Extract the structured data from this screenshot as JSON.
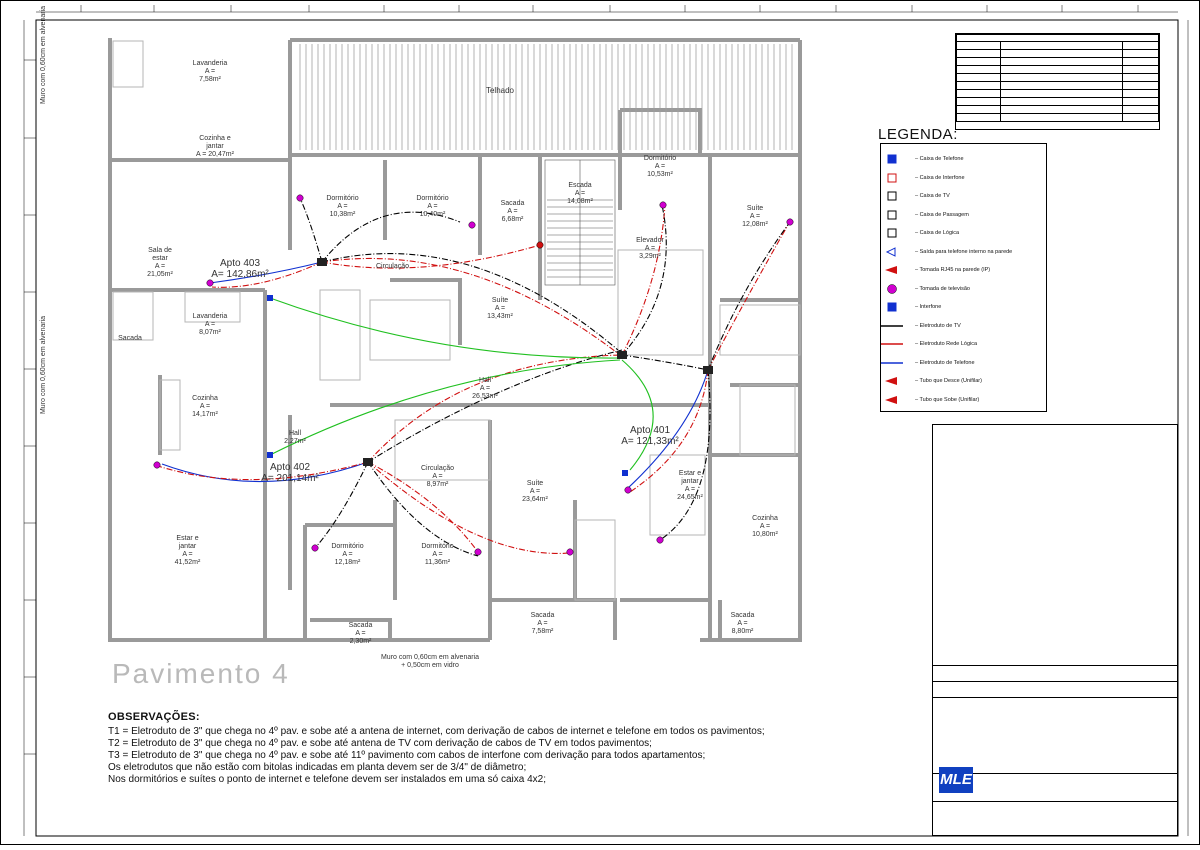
{
  "title": "Pavimento 4",
  "legend": {
    "title": "LEGENDA:",
    "items": [
      {
        "label": "Caixa de Telefone",
        "icon": "phone-box-icon",
        "color": "#1030d0"
      },
      {
        "label": "Caixa de Interfone",
        "icon": "intercom-box-icon",
        "color": "#d01010"
      },
      {
        "label": "Caixa de TV",
        "icon": "tv-box-icon",
        "color": "#000000"
      },
      {
        "label": "Caixa de Passagem",
        "icon": "pass-box-icon",
        "color": "#000000"
      },
      {
        "label": "Caixa de Lógica",
        "icon": "logic-box-icon",
        "color": "#000000"
      },
      {
        "label": "Saída para telefone interno na parede",
        "icon": "phone-outlet-icon",
        "color": "#1030d0"
      },
      {
        "label": "Tomada RJ45 na parede (IP)",
        "icon": "rj45-outlet-icon",
        "color": "#d01010"
      },
      {
        "label": "Tomada de televisão",
        "icon": "tv-outlet-icon",
        "color": "#d000d0"
      },
      {
        "label": "Interfone",
        "icon": "intercom-icon",
        "color": "#1030d0"
      },
      {
        "label": "Eletroduto de TV",
        "icon": "tv-conduit-line",
        "color": "#000000"
      },
      {
        "label": "Eletroduto Rede Lógica",
        "icon": "logic-conduit-line",
        "color": "#d01010"
      },
      {
        "label": "Eletroduto de Telefone",
        "icon": "phone-conduit-line",
        "color": "#1030d0"
      },
      {
        "label": "Tubo que Desce (Unifilar)",
        "icon": "pipe-down-icon",
        "color": "#d01010"
      },
      {
        "label": "Tubo que Sobe (Unifilar)",
        "icon": "pipe-up-icon",
        "color": "#d01010"
      }
    ]
  },
  "observacoes": {
    "title": "OBSERVAÇÕES:",
    "lines": [
      "T1 = Eletroduto de 3\" que chega no 4º pav. e sobe até a antena de internet, com derivação de cabos de internet e telefone em todos os pavimentos;",
      "T2 = Eletroduto de 3\" que chega no 4º pav. e sobe até antena de TV com derivação de cabos de TV em todos pavimentos;",
      "T3 = Eletroduto de 3\" que chega no 4º pav. e sobe até 11º pavimento com cabos de interfone com derivação para todos apartamentos;",
      "Os eletrodutos que não estão com bitolas indicadas em planta devem ser de 3/4\" de diâmetro;",
      "Nos dormitórios e suítes o ponto de internet e telefone devem ser instalados em uma só caixa 4x2;"
    ]
  },
  "rooms": [
    {
      "name": "Lavanderia\nA =\n7,58m²"
    },
    {
      "name": "Cozinha e\njantar\nA = 20,47m²"
    },
    {
      "name": "Sala de\nestar\nA =\n21,05m²"
    },
    {
      "name": "Apto 403\nA= 142,86m²"
    },
    {
      "name": "Dormitório\nA =\n10,38m²"
    },
    {
      "name": "Dormitório\nA =\n10,40m²"
    },
    {
      "name": "Sacada\nA =\n6,68m²"
    },
    {
      "name": "Escada\nA =\n14,08m²"
    },
    {
      "name": "Dormitório\nA =\n10,53m²"
    },
    {
      "name": "Suíte\nA =\n12,08m²"
    },
    {
      "name": "Elevador\nA =\n3,29m²"
    },
    {
      "name": "Circulação"
    },
    {
      "name": "Suíte\nA =\n13,43m²"
    },
    {
      "name": "Lavanderia\nA =\n8,07m²"
    },
    {
      "name": "Cozinha\nA =\n14,17m²"
    },
    {
      "name": "Hall\nA =\n26,53m²"
    },
    {
      "name": "Apto 402\nA= 201,14m²"
    },
    {
      "name": "Hall\n2,27m²"
    },
    {
      "name": "Circulação\nA =\n8,97m²"
    },
    {
      "name": "Suíte\nA =\n23,64m²"
    },
    {
      "name": "Estar e\njantar\nA =\n41,52m²"
    },
    {
      "name": "Dormitório\nA =\n12,18m²"
    },
    {
      "name": "Dormitório\nA =\n11,36m²"
    },
    {
      "name": "Sacada\nA =\n7,58m²"
    },
    {
      "name": "Sacada\nA =\n8,80m²"
    },
    {
      "name": "Cozinha\nA =\n10,80m²"
    },
    {
      "name": "Apto 401\nA= 121,33m²"
    },
    {
      "name": "Estar e\njantar\nA =\n24,65m²"
    },
    {
      "name": "Sacada"
    },
    {
      "name": "Sacada\nA =\n2,30m²"
    }
  ],
  "plan_labels": {
    "muro_left_top": "Muro com 0,60cm em alvenaria",
    "muro_left_bottom": "Muro com 0,60cm em alvenaria",
    "muro_bottom": "Muro com 0,60cm em alvenaria\n+ 0,50cm em vidro",
    "telhado": "Telhado"
  },
  "colors": {
    "tv": "#000000",
    "logic": "#d01010",
    "phone": "#1030d0",
    "green": "#20c020",
    "magenta": "#d000d0",
    "wall": "#9a9a9a",
    "pav_text": "#b9b9b9"
  },
  "titleblock": {
    "company": "MLE"
  }
}
